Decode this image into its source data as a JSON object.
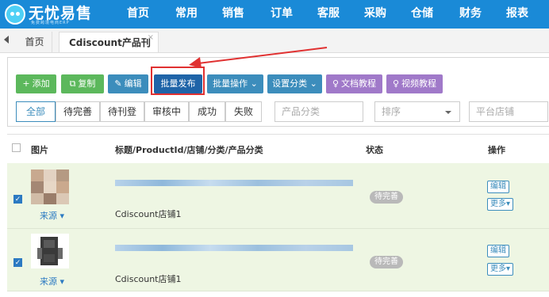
{
  "logo": {
    "name": "无忧易售",
    "tagline": "免费跨境电商ERP"
  },
  "nav": [
    "首页",
    "常用",
    "销售",
    "订单",
    "客服",
    "采购",
    "仓储",
    "财务",
    "报表"
  ],
  "tabs": [
    {
      "label": "首页"
    },
    {
      "label": "Cdiscount产品刊登",
      "close": "×"
    }
  ],
  "toolbar": {
    "add": "添加",
    "copy": "复制",
    "edit": "编辑",
    "batch_publish": "批量发布",
    "batch_ops": "批量操作",
    "set_category": "设置分类",
    "doc": "文档教程",
    "video": "视频教程"
  },
  "filters": [
    "全部",
    "待完善",
    "待刊登",
    "审核中",
    "成功",
    "失败"
  ],
  "fields": {
    "category": "产品分类",
    "sort": "排序",
    "shop": "平台店铺"
  },
  "table": {
    "headers": {
      "image": "图片",
      "title": "标题/ProductId/店铺/分类/产品分类",
      "status": "状态",
      "ops": "操作"
    },
    "rows": [
      {
        "shop": "Cdiscount店铺1",
        "source": "来源",
        "status": "待完善",
        "edit": "编辑",
        "more": "更多"
      },
      {
        "shop": "Cdiscount店铺1",
        "source": "来源",
        "status": "待完善",
        "edit": "编辑",
        "more": "更多"
      }
    ]
  },
  "colors": {
    "nav": "#1a8ad7",
    "green": "#5cb85c",
    "blue": "#3c8dbc",
    "purple": "#a079c9",
    "highlight": "#e03131"
  }
}
